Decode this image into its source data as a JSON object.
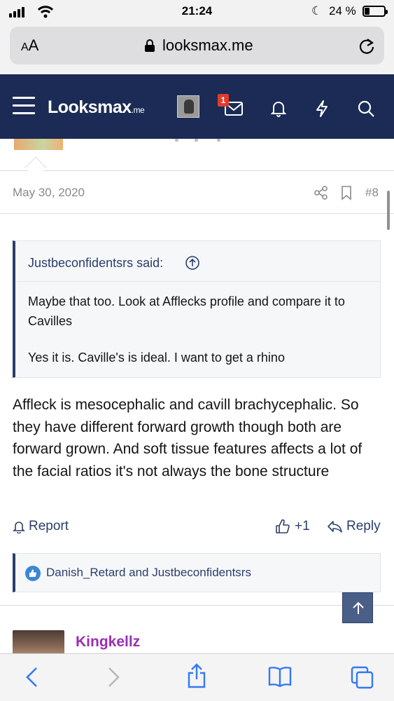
{
  "status_bar": {
    "time": "21:24",
    "battery_text": "24 %",
    "battery_level": 0.24
  },
  "browser": {
    "text_size_label_small": "A",
    "text_size_label_large": "A",
    "url": "looksmax.me"
  },
  "site_header": {
    "logo_main": "Looksmax",
    "logo_suffix": ".me",
    "inbox_count": "1"
  },
  "post": {
    "date": "May 30, 2020",
    "number": "#8",
    "quote": {
      "author_line": "Justbeconfidentsrs said:",
      "paragraphs": [
        "Maybe that too. Look at Afflecks profile and compare it to Cavilles",
        "Yes it is. Caville's is ideal. I want to get a rhino"
      ]
    },
    "body": "Affleck is mesocephalic and cavill brachycephalic. So they have different forward growth though both are forward grown. And soft tissue features affects a lot of the facial ratios it's not always the bone structure",
    "actions": {
      "report": "Report",
      "like_count": "+1",
      "reply": "Reply"
    },
    "reactions_text": "Danish_Retard and Justbeconfidentsrs"
  },
  "next_post": {
    "username": "Kingkellz"
  },
  "colors": {
    "header_bg": "#1b2b55",
    "link": "#2b3e6b",
    "username_purple": "#9a2fb3",
    "badge_red": "#e03c2e"
  },
  "icons": [
    "signal-icon",
    "wifi-icon",
    "moon-icon",
    "battery-icon",
    "lock-icon",
    "reload-icon",
    "menu-icon",
    "inbox-icon",
    "bell-icon",
    "bolt-icon",
    "search-icon",
    "share-icon",
    "bookmark-icon",
    "arrow-up-circle-icon",
    "bell-outline-icon",
    "thumbs-up-icon",
    "reply-icon",
    "like-reaction-icon",
    "arrow-up-icon",
    "back-icon",
    "forward-icon",
    "share-sheet-icon",
    "book-icon",
    "tabs-icon"
  ]
}
